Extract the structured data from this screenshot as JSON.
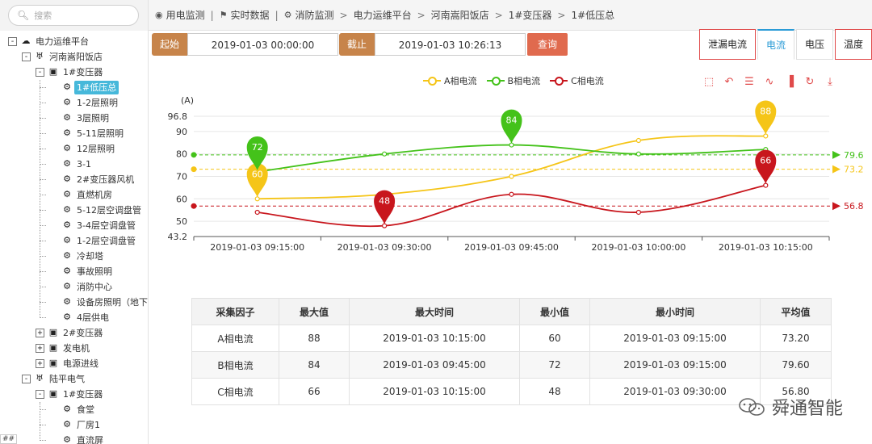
{
  "sidebar": {
    "search_placeholder": "搜索",
    "tree": [
      {
        "label": "电力运维平台",
        "icon": "platform-icon",
        "depth": 0,
        "toggle": "-"
      },
      {
        "label": "河南嵩阳饭店",
        "icon": "tower-icon",
        "depth": 1,
        "toggle": "-"
      },
      {
        "label": "1#变压器",
        "icon": "transformer-icon",
        "depth": 2,
        "toggle": "-"
      },
      {
        "label": "1#低压总",
        "icon": "meter-icon",
        "depth": 3,
        "selected": true
      },
      {
        "label": "1-2层照明",
        "icon": "meter-icon",
        "depth": 3
      },
      {
        "label": "3层照明",
        "icon": "meter-icon",
        "depth": 3
      },
      {
        "label": "5-11层照明",
        "icon": "meter-icon",
        "depth": 3
      },
      {
        "label": "12层照明",
        "icon": "meter-icon",
        "depth": 3
      },
      {
        "label": "3-1",
        "icon": "meter-icon",
        "depth": 3
      },
      {
        "label": "2#变压器风机",
        "icon": "meter-icon",
        "depth": 3
      },
      {
        "label": "直燃机房",
        "icon": "meter-icon",
        "depth": 3
      },
      {
        "label": "5-12层空调盘管",
        "icon": "meter-icon",
        "depth": 3
      },
      {
        "label": "3-4层空调盘管",
        "icon": "meter-icon",
        "depth": 3
      },
      {
        "label": "1-2层空调盘管",
        "icon": "meter-icon",
        "depth": 3
      },
      {
        "label": "冷却塔",
        "icon": "meter-icon",
        "depth": 3
      },
      {
        "label": "事故照明",
        "icon": "meter-icon",
        "depth": 3
      },
      {
        "label": "消防中心",
        "icon": "meter-icon",
        "depth": 3
      },
      {
        "label": "设备房照明（地下",
        "icon": "meter-icon",
        "depth": 3
      },
      {
        "label": "4层供电",
        "icon": "meter-icon",
        "depth": 3
      },
      {
        "label": "2#变压器",
        "icon": "transformer-icon",
        "depth": 2,
        "toggle": "+"
      },
      {
        "label": "发电机",
        "icon": "transformer-icon",
        "depth": 2,
        "toggle": "+"
      },
      {
        "label": "电源进线",
        "icon": "transformer-icon",
        "depth": 2,
        "toggle": "+"
      },
      {
        "label": "陆平电气",
        "icon": "tower-icon",
        "depth": 1,
        "toggle": "-"
      },
      {
        "label": "1#变压器",
        "icon": "transformer-icon",
        "depth": 2,
        "toggle": "-"
      },
      {
        "label": "食堂",
        "icon": "meter-icon",
        "depth": 3
      },
      {
        "label": "厂房1",
        "icon": "meter-icon",
        "depth": 3
      },
      {
        "label": "直流屏",
        "icon": "meter-icon",
        "depth": 3
      }
    ],
    "corner_tag": "##"
  },
  "breadcrumb": [
    {
      "label": "用电监测",
      "icon": "eye-icon"
    },
    {
      "label": "实时数据",
      "icon": "flag-icon"
    },
    {
      "label": "消防监测",
      "icon": "gear-icon"
    },
    {
      "label": "电力运维平台"
    },
    {
      "label": "河南嵩阳饭店"
    },
    {
      "label": "1#变压器"
    },
    {
      "label": "1#低压总"
    }
  ],
  "query": {
    "start_label": "起始",
    "start_value": "2019-01-03 00:00:00",
    "end_label": "截止",
    "end_value": "2019-01-03 10:26:13",
    "submit_label": "查询"
  },
  "tabs": [
    {
      "label": "泄漏电流",
      "outlined": true
    },
    {
      "label": "电流",
      "active": true
    },
    {
      "label": "电压"
    },
    {
      "label": "温度",
      "outlined": true
    }
  ],
  "toolbox": [
    "zoom-icon",
    "zoom-reset-icon",
    "data-view-icon",
    "line-switch-icon",
    "bar-switch-icon",
    "restore-icon",
    "download-icon"
  ],
  "chart_data": {
    "type": "line",
    "ylabel": "(A)",
    "categories": [
      "2019-01-03 09:15:00",
      "2019-01-03 09:30:00",
      "2019-01-03 09:45:00",
      "2019-01-03 10:00:00",
      "2019-01-03 10:15:00"
    ],
    "ylim": [
      43.2,
      96.8
    ],
    "yticks": [
      "96.8",
      "90",
      "80",
      "70",
      "60",
      "50",
      "43.2"
    ],
    "legend_position": "top-center",
    "grid": true,
    "series": [
      {
        "name": "A相电流",
        "color": "#f5c518",
        "values": [
          60,
          62,
          70,
          86,
          88
        ],
        "max": {
          "index": 4,
          "value": 88
        },
        "min": {
          "index": 0,
          "value": 60
        },
        "average": 73.2
      },
      {
        "name": "B相电流",
        "color": "#44c21a",
        "values": [
          72,
          80,
          84,
          80,
          82
        ],
        "max": {
          "index": 2,
          "value": 84
        },
        "min": {
          "index": 0,
          "value": 72
        },
        "average": 79.6
      },
      {
        "name": "C相电流",
        "color": "#c8161d",
        "values": [
          54,
          48,
          62,
          54,
          66
        ],
        "max": {
          "index": 4,
          "value": 66
        },
        "min": {
          "index": 1,
          "value": 48
        },
        "average": 56.8
      }
    ]
  },
  "table": {
    "headers": [
      "采集因子",
      "最大值",
      "最大时间",
      "最小值",
      "最小时间",
      "平均值"
    ],
    "rows": [
      [
        "A相电流",
        "88",
        "2019-01-03 10:15:00",
        "60",
        "2019-01-03 09:15:00",
        "73.20"
      ],
      [
        "B相电流",
        "84",
        "2019-01-03 09:45:00",
        "72",
        "2019-01-03 09:15:00",
        "79.60"
      ],
      [
        "C相电流",
        "66",
        "2019-01-03 10:15:00",
        "48",
        "2019-01-03 09:30:00",
        "56.80"
      ]
    ]
  },
  "watermark": {
    "text": "舜通智能",
    "icon": "wechat-icon"
  }
}
